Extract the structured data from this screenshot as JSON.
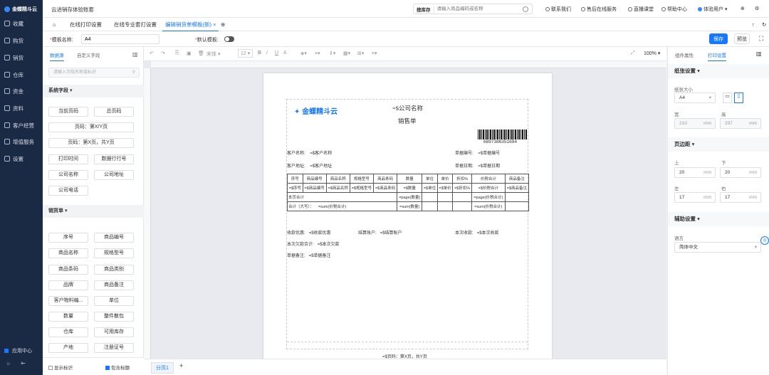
{
  "nav": {
    "brand": "金蝶精斗云",
    "items": [
      "收藏",
      "购货",
      "销货",
      "仓库",
      "资金",
      "资料",
      "客户经营",
      "增值服务",
      "设置"
    ],
    "app_center": "应用中心"
  },
  "header": {
    "title": "云进销存体验账套",
    "search_scope": "搜库存",
    "search_placeholder": "请输入商品编码或名称",
    "links": [
      "联系我们",
      "售后在线服务",
      "直播课堂",
      "帮助中心",
      "体验用户"
    ]
  },
  "tabs": [
    "在线打印设置",
    "在线专业套打设置",
    "编辑销货单模板(新)"
  ],
  "form": {
    "template_label": "模板名称:",
    "template_value": "A4",
    "default_label": "默认模板:",
    "save": "保存",
    "preview": "预览"
  },
  "left_panel": {
    "tabs": [
      "数据源",
      "自定义字段"
    ],
    "search_placeholder": "请输入字段名称或标识",
    "system_section": "系统字段",
    "system_fields": [
      "当前页码",
      "总页码",
      "页码：第X/Y页",
      "页码：第X页，共Y页",
      "打印时间",
      "数据行行号",
      "公司名称",
      "公司地址",
      "公司电话"
    ],
    "order_section": "销货单",
    "order_fields": [
      "序号",
      "商品编号",
      "商品名称",
      "规格型号",
      "商品条码",
      "商品类别",
      "品牌",
      "商品备注",
      "客户物料编...",
      "单位",
      "数量",
      "整件散包",
      "仓库",
      "可用库存",
      "产地",
      "注册证号"
    ],
    "footer_show": "显示标识",
    "footer_include": "包含标题"
  },
  "editor": {
    "font": "宋体",
    "font_size": "12",
    "zoom": "100%",
    "sheet_tab": "分页1"
  },
  "paper": {
    "logo": "金蝶精斗云",
    "company": "=$公司名称",
    "doc_title": "销售单",
    "barcode_no": "6897386351694",
    "customer_label": "客户名称:",
    "customer_value": "=$客户名称",
    "order_no_label": "单据编号:",
    "order_no_value": "=$单据编号",
    "address_label": "客户地址:",
    "address_value": "=$客户地址",
    "date_label": "单据日期:",
    "date_value": "=$单据日期",
    "table_headers": [
      "序号",
      "商品编号",
      "商品名称",
      "规格型号",
      "商品条码",
      "数量",
      "单位",
      "单价",
      "折扣%",
      "价税合计",
      "商品备注"
    ],
    "table_row": [
      "=$序号",
      "=$商品编号",
      "=$商品名称",
      "=$规格型号",
      "=$商品条码",
      "=$数量",
      "=$单位",
      "=$单价",
      "=$折扣%",
      "=$价税合计",
      "=$商品备注"
    ],
    "page_total_label": "本页合计",
    "page_total_qty": "=page(数量)",
    "page_total_amt": "=page(价税合计)",
    "grand_total_label": "合计（大写）：",
    "grand_total_text": "=sum(价税合计)",
    "grand_total_qty": "=sum(数量)",
    "grand_total_amt": "=sum(价税合计)",
    "discount_label": "收款优惠:",
    "discount_value": "=$收款优惠",
    "account_label": "结算账户:",
    "account_value": "=$结算账户",
    "received_label": "本次收款:",
    "received_value": "=$本次收款",
    "arrears_label": "本次欠款合计:",
    "arrears_value": "=$本次欠款",
    "remark_label": "单据备注:",
    "remark_value": "=$单据备注",
    "footer": "=$页码：第X页，共Y页"
  },
  "right_panel": {
    "tabs": [
      "组件属性",
      "打印设置"
    ],
    "paper_section": "纸张设置",
    "paper_size_label": "纸张大小",
    "paper_size": "A4",
    "width_label": "宽",
    "width": "210",
    "height_label": "高",
    "height": "297",
    "unit": "mm",
    "margin_section": "页边距",
    "top_label": "上",
    "top": "20",
    "bottom_label": "下",
    "bottom": "20",
    "left_label": "左",
    "left": "17",
    "right_label": "右",
    "right": "17",
    "aux_section": "辅助设置",
    "lang_label": "语言",
    "lang": "简体中文"
  },
  "colors": {
    "accent": "#1677ff",
    "nav_bg": "#1b2a44"
  }
}
